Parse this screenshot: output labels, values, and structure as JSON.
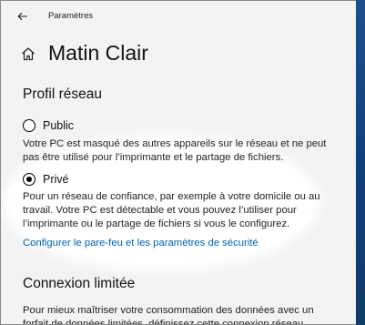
{
  "window": {
    "title": "Paramètres"
  },
  "header": {
    "page_title": "Matin Clair"
  },
  "network_profile": {
    "heading": "Profil réseau",
    "options": [
      {
        "label": "Public",
        "selected": false,
        "description": "Votre PC est masqué des autres appareils sur le réseau et ne peut pas être utilisé pour l’imprimante et le partage de fichiers."
      },
      {
        "label": "Privé",
        "selected": true,
        "description": "Pour un réseau de confiance, par exemple à votre domicile ou au travail. Votre PC est détectable et vous pouvez l’utiliser pour l’imprimante ou le partage de fichiers si vous le configurez."
      }
    ],
    "firewall_link": "Configurer le pare-feu et les paramètres de sécurité"
  },
  "metered_connection": {
    "heading": "Connexion limitée",
    "description": "Pour mieux maîtriser votre consommation des données avec un forfait de données limitées, définissez cette connexion réseau"
  },
  "icons": {
    "back": "back-arrow-icon",
    "home": "home-icon"
  },
  "colors": {
    "link": "#0063b1",
    "background": "#f3f3f3",
    "highlight": "#ffffff"
  }
}
